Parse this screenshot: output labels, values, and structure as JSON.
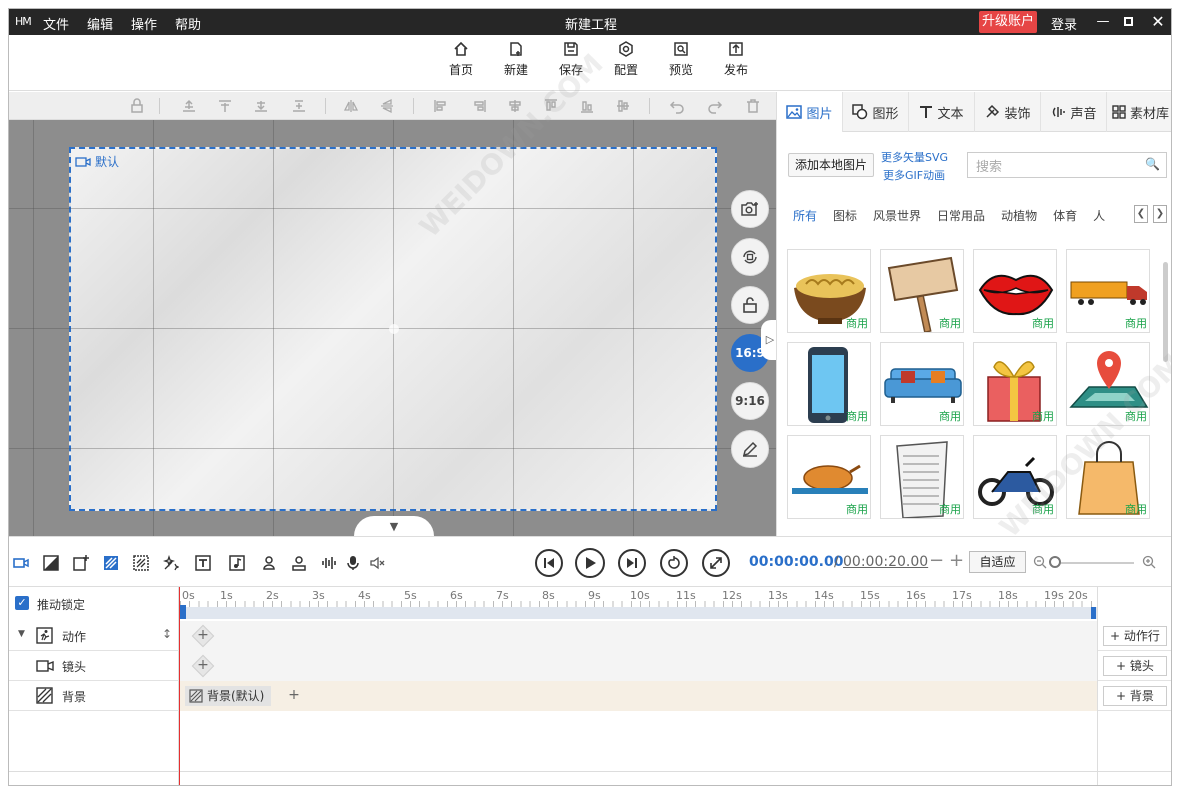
{
  "window": {
    "title": "新建工程",
    "logo": "HM",
    "upgrade": "升级账户",
    "login": "登录"
  },
  "menu": [
    "文件",
    "编辑",
    "操作",
    "帮助"
  ],
  "toolbar": [
    {
      "label": "首页",
      "icon": "home-icon"
    },
    {
      "label": "新建",
      "icon": "new-icon"
    },
    {
      "label": "保存",
      "icon": "save-icon"
    },
    {
      "label": "配置",
      "icon": "settings-icon"
    },
    {
      "label": "预览",
      "icon": "preview-icon"
    },
    {
      "label": "发布",
      "icon": "publish-icon"
    }
  ],
  "canvas": {
    "stage_label": "默认",
    "ratio_16_9": "16:9",
    "ratio_9_16": "9:16",
    "accent": "#2a6fc9"
  },
  "right_panel": {
    "tabs": [
      {
        "label": "图片",
        "icon": "image-icon"
      },
      {
        "label": "图形",
        "icon": "shape-icon"
      },
      {
        "label": "文本",
        "icon": "text-icon"
      },
      {
        "label": "装饰",
        "icon": "decor-icon"
      },
      {
        "label": "声音",
        "icon": "sound-icon"
      },
      {
        "label": "素材库",
        "icon": "library-icon"
      }
    ],
    "add_local": "添加本地图片",
    "more_svg": "更多矢量SVG",
    "more_gif": "更多GIF动画",
    "search_placeholder": "搜索",
    "categories": [
      "所有",
      "图标",
      "风景世界",
      "日常用品",
      "动植物",
      "体育",
      "人"
    ],
    "items": [
      {
        "name": "noodles",
        "tag": "商用"
      },
      {
        "name": "wooden-sign",
        "tag": "商用"
      },
      {
        "name": "lips",
        "tag": "商用"
      },
      {
        "name": "truck",
        "tag": "商用"
      },
      {
        "name": "phone",
        "tag": "商用"
      },
      {
        "name": "sofa",
        "tag": "商用"
      },
      {
        "name": "gift",
        "tag": "商用"
      },
      {
        "name": "map-pin",
        "tag": "商用"
      },
      {
        "name": "roast-chicken",
        "tag": "商用"
      },
      {
        "name": "paper-stack",
        "tag": "商用"
      },
      {
        "name": "motorcycle",
        "tag": "商用"
      },
      {
        "name": "shopping-bag",
        "tag": "商用"
      }
    ]
  },
  "timeline": {
    "current_time": "00:00:00.00",
    "separator": "/",
    "total_time": "00:00:20.00",
    "fit": "自适应",
    "lock_label": "推动锁定",
    "ticks": [
      "0s",
      "1s",
      "2s",
      "3s",
      "4s",
      "5s",
      "6s",
      "7s",
      "8s",
      "9s",
      "10s",
      "11s",
      "12s",
      "13s",
      "14s",
      "15s",
      "16s",
      "17s",
      "18s",
      "19s",
      "20s"
    ],
    "tracks": [
      {
        "label": "动作",
        "add": "动作行"
      },
      {
        "label": "镜头",
        "add": "镜头"
      },
      {
        "label": "背景",
        "add": "背景"
      }
    ],
    "bg_clip": "背景(默认)"
  },
  "watermark": "WEIDOWN.COM"
}
